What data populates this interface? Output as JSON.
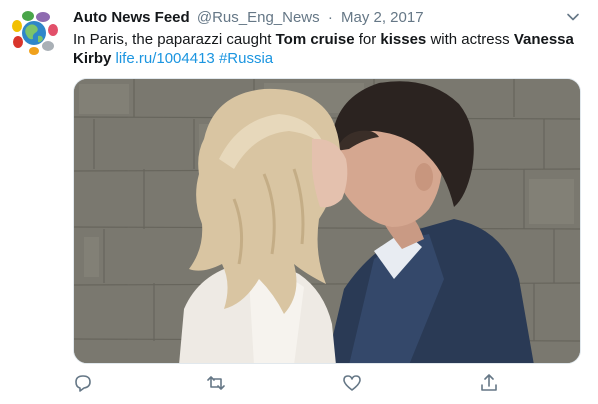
{
  "tweet": {
    "author_name": "Auto News Feed",
    "author_handle": "@Rus_Eng_News",
    "separator": "·",
    "date": "May 2, 2017",
    "text_parts": {
      "p1": "In Paris, the paparazzi caught ",
      "p2": "Tom cruise",
      "p3": " for ",
      "p4": "kisses",
      "p5": " with actress ",
      "p6": "Vanessa Kirby",
      "p7": " ",
      "link": "life.ru/1004413",
      "p8": " ",
      "hashtag": "#Russia"
    }
  },
  "icons": {
    "avatar": "colorful-globe-logo",
    "caret": "chevron-down-icon",
    "reply": "reply-icon",
    "retweet": "retweet-icon",
    "like": "heart-icon",
    "share": "share-icon"
  },
  "colors": {
    "link": "#1b95e0",
    "secondary_text": "#657786",
    "primary_text": "#14171a",
    "icon": "#657786"
  }
}
